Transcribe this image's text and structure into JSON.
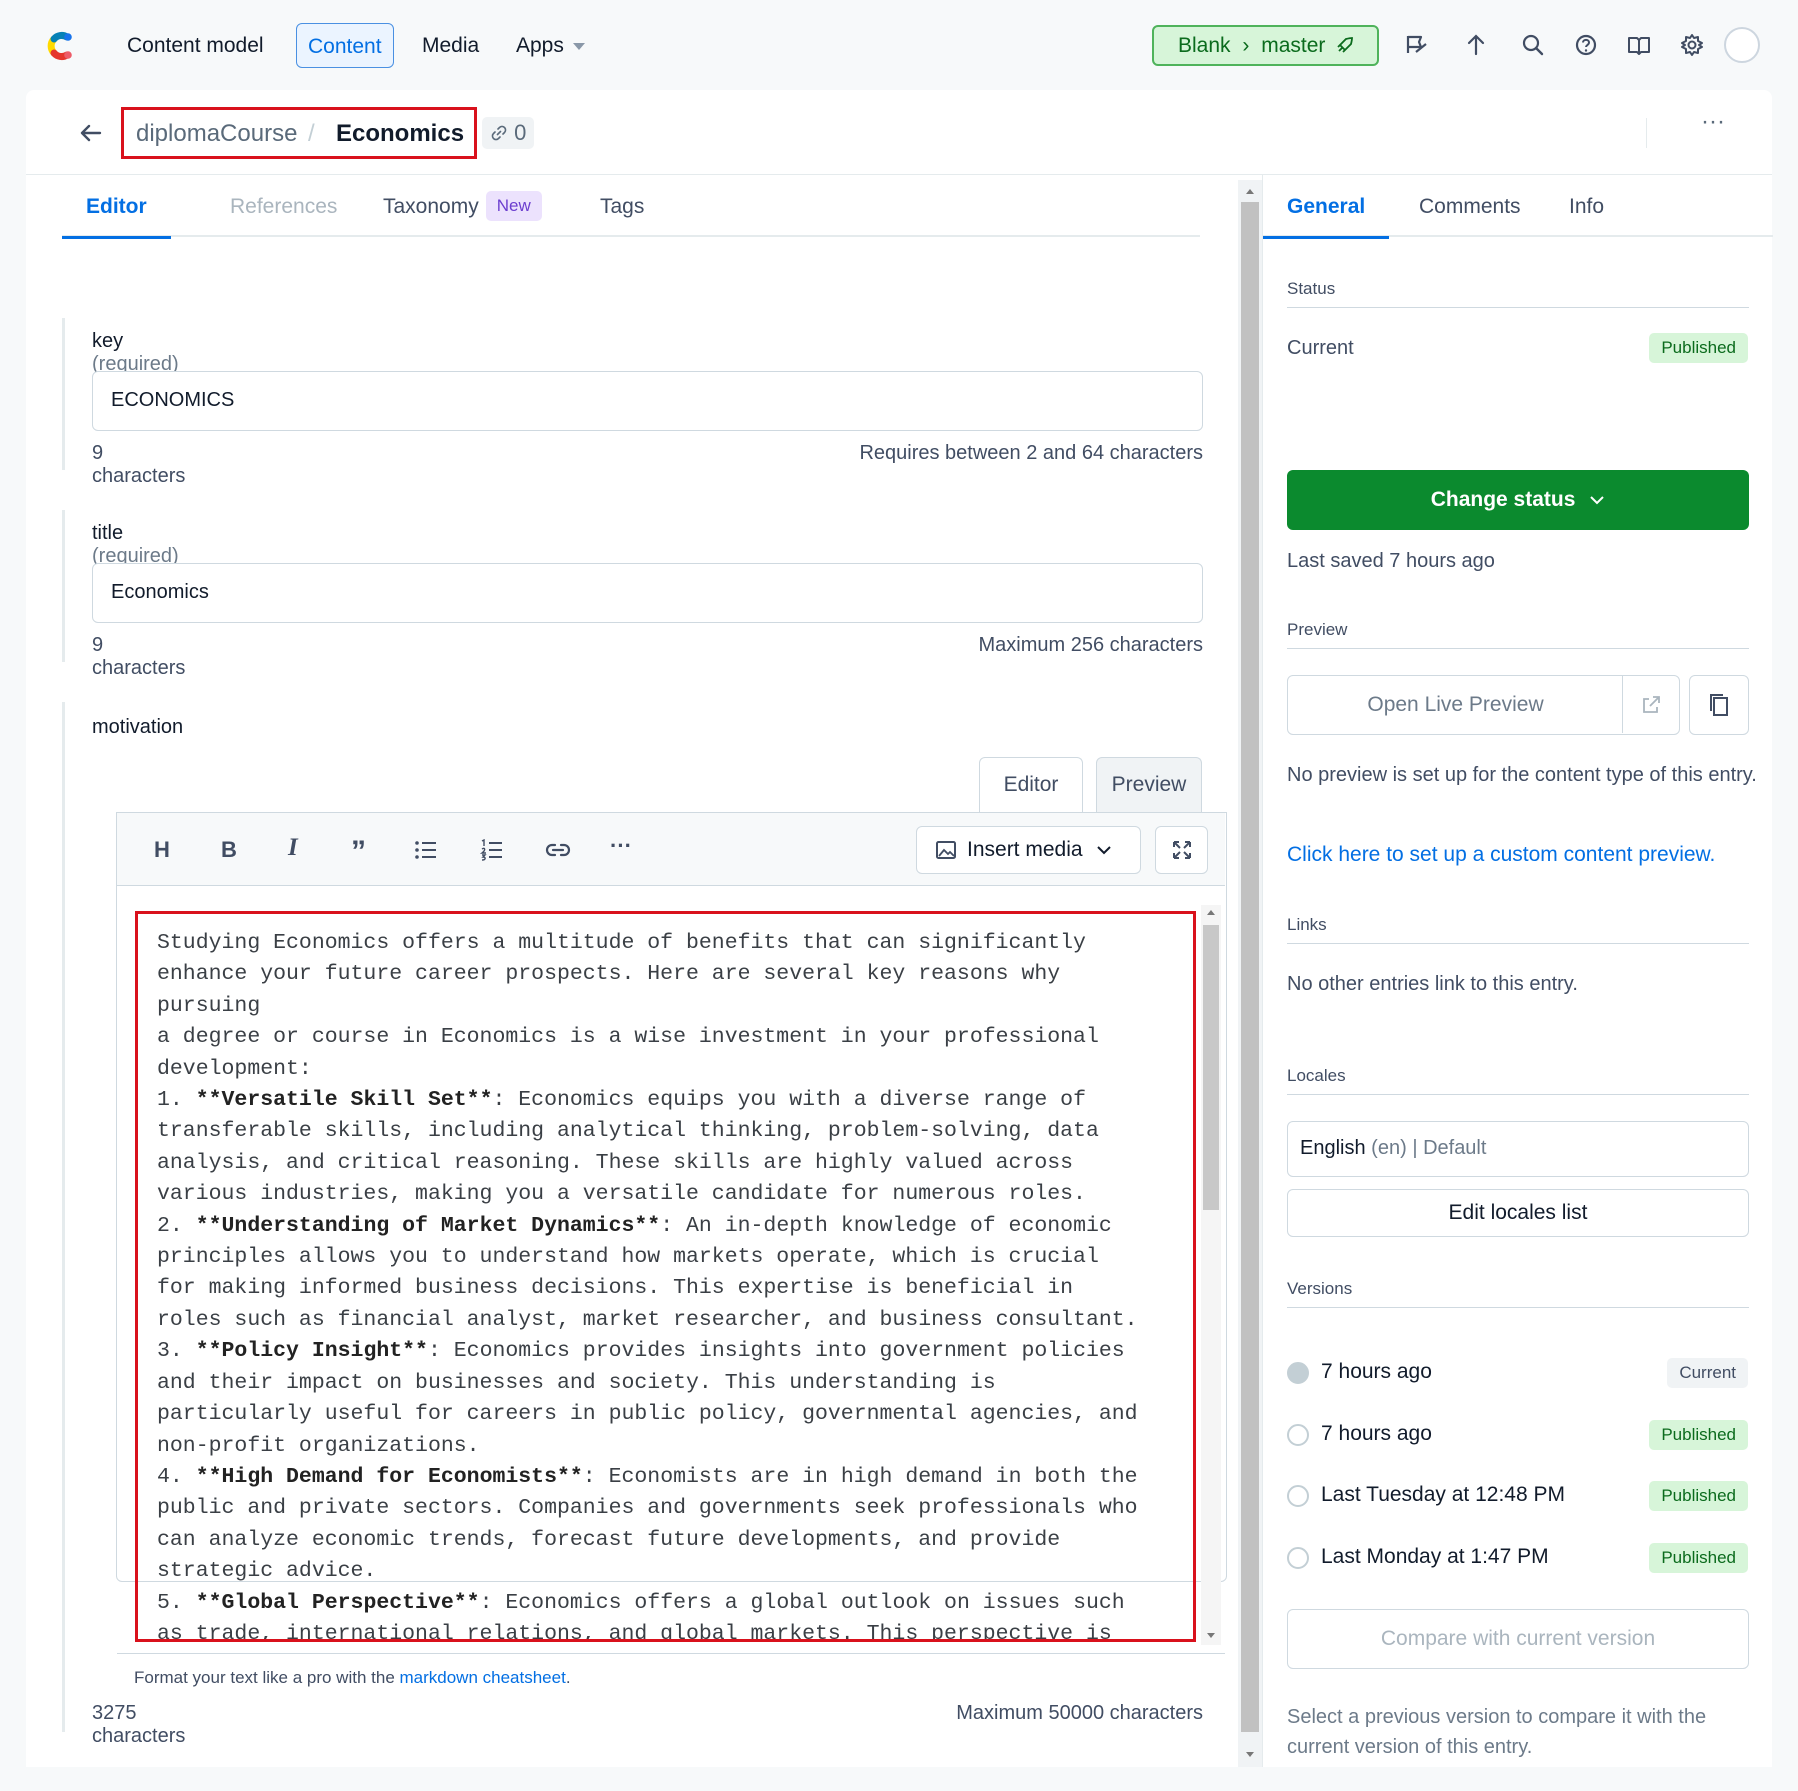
{
  "topnav": {
    "content_model": "Content model",
    "content": "Content",
    "media": "Media",
    "apps": "Apps",
    "env_space": "Blank",
    "env_branch": "master"
  },
  "header": {
    "content_type": "diplomaCourse",
    "entry_title": "Economics",
    "references_count": "0",
    "more": "···"
  },
  "tabs": {
    "editor": "Editor",
    "references": "References",
    "taxonomy": "Taxonomy",
    "taxonomy_badge": "New",
    "tags": "Tags"
  },
  "fields": {
    "key": {
      "label": "key",
      "required": "(required)",
      "value": "ECONOMICS",
      "count": "9 characters",
      "rule": "Requires between 2 and 64 characters"
    },
    "title": {
      "label": "title",
      "required": "(required)",
      "value": "Economics",
      "count": "9 characters",
      "rule": "Maximum 256 characters"
    },
    "motivation": {
      "label": "motivation",
      "tab_editor": "Editor",
      "tab_preview": "Preview",
      "toolbar": {
        "heading": "H",
        "bold": "B",
        "italic": "I",
        "quote": "”",
        "more": "···",
        "insert_media": "Insert media"
      },
      "lines": [
        "Studying Economics offers a multitude of benefits that can significantly",
        "enhance your future career prospects. Here are several key reasons why pursuing",
        "a degree or course in Economics is a wise investment in your professional",
        "development:"
      ],
      "points": [
        {
          "num": "1. ",
          "title": "**Versatile Skill Set**",
          "text": ": Economics equips you with a diverse range of transferable skills, including analytical thinking, problem-solving, data analysis, and critical reasoning. These skills are highly valued across various industries, making you a versatile candidate for numerous roles."
        },
        {
          "num": "2. ",
          "title": "**Understanding of Market Dynamics**",
          "text": ": An in-depth knowledge of economic principles allows you to understand how markets operate, which is crucial for making informed business decisions. This expertise is beneficial in roles such as financial analyst, market researcher, and business consultant."
        },
        {
          "num": "3. ",
          "title": "**Policy Insight**",
          "text": ": Economics provides insights into government policies and their impact on businesses and society. This understanding is particularly useful for careers in public policy, governmental agencies, and non-profit organizations."
        },
        {
          "num": "4. ",
          "title": "**High Demand for Economists**",
          "text": ": Economists are in high demand in both the public and private sectors. Companies and governments seek professionals who can analyze economic trends, forecast future developments, and provide strategic advice."
        },
        {
          "num": "5. ",
          "title": "**Global Perspective**",
          "text": ": Economics offers a global outlook on issues such as trade, international relations, and global markets. This perspective is invaluable for careers in international business, diplomacy, and global"
        }
      ],
      "footer_prefix": "Format your text like a pro with the ",
      "footer_link": "markdown cheatsheet",
      "footer_suffix": ".",
      "count": "3275 characters",
      "rule": "Maximum 50000 characters"
    }
  },
  "sidebar": {
    "tabs": {
      "general": "General",
      "comments": "Comments",
      "info": "Info"
    },
    "status": {
      "heading": "Status",
      "current_label": "Current",
      "current_badge": "Published",
      "change_button": "Change status",
      "last_saved": "Last saved 7 hours ago"
    },
    "preview": {
      "heading": "Preview",
      "open_button": "Open Live Preview",
      "note": "No preview is set up for the content type of this entry.",
      "link": "Click here to set up a custom content preview."
    },
    "links": {
      "heading": "Links",
      "note": "No other entries link to this entry."
    },
    "locales": {
      "heading": "Locales",
      "locale_name": "English",
      "locale_code": "(en)",
      "locale_default": "| Default",
      "edit_button": "Edit locales list"
    },
    "versions": {
      "heading": "Versions",
      "items": [
        {
          "label": "7 hours ago",
          "badge": "Current"
        },
        {
          "label": "7 hours ago",
          "badge": "Published"
        },
        {
          "label": "Last Tuesday at 12:48 PM",
          "badge": "Published"
        },
        {
          "label": "Last Monday at 1:47 PM",
          "badge": "Published"
        }
      ],
      "compare_button": "Compare with current version",
      "note": "Select a previous version to compare it with the current version of this entry."
    }
  },
  "colors": {
    "accent": "#036fe3",
    "success": "#0b8a2e",
    "highlight": "#d9111c"
  }
}
